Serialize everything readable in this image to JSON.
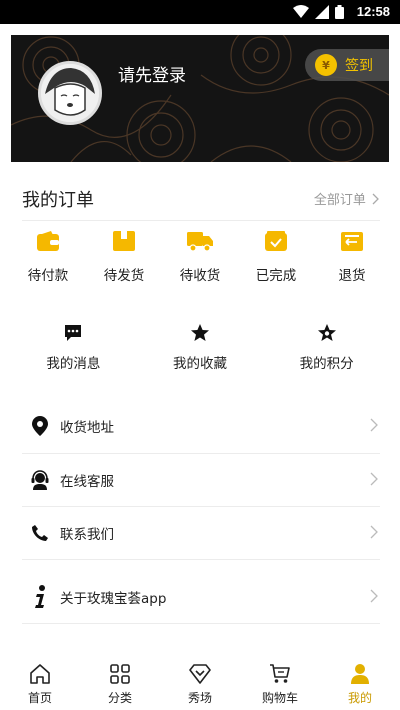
{
  "status_bar": {
    "time": "12:58"
  },
  "profile": {
    "login_prompt": "请先登录",
    "signin_label": "签到",
    "coin_symbol": "¥"
  },
  "orders": {
    "title": "我的订单",
    "all_label": "全部订单",
    "items": [
      {
        "label": "待付款",
        "icon": "wallet-icon"
      },
      {
        "label": "待发货",
        "icon": "box-icon"
      },
      {
        "label": "待收货",
        "icon": "truck-icon"
      },
      {
        "label": "已完成",
        "icon": "check-box-icon"
      },
      {
        "label": "退货",
        "icon": "return-icon"
      }
    ]
  },
  "shortcuts": [
    {
      "label": "我的消息",
      "icon": "message-icon"
    },
    {
      "label": "我的收藏",
      "icon": "star-icon"
    },
    {
      "label": "我的积分",
      "icon": "star-points-icon"
    }
  ],
  "menu": [
    {
      "label": "收货地址",
      "icon": "location-pin-icon"
    },
    {
      "label": "在线客服",
      "icon": "customer-service-icon"
    },
    {
      "label": "联系我们",
      "icon": "phone-icon"
    },
    {
      "label": "关于玫瑰宝荟app",
      "icon": "info-icon"
    }
  ],
  "tabbar": [
    {
      "label": "首页",
      "icon": "home-icon"
    },
    {
      "label": "分类",
      "icon": "grid-icon"
    },
    {
      "label": "秀场",
      "icon": "diamond-icon"
    },
    {
      "label": "购物车",
      "icon": "cart-icon"
    },
    {
      "label": "我的",
      "icon": "user-icon",
      "active": true
    }
  ],
  "colors": {
    "accent": "#f2c200",
    "active_tab": "#c99a00",
    "banner_bg": "#141414"
  }
}
